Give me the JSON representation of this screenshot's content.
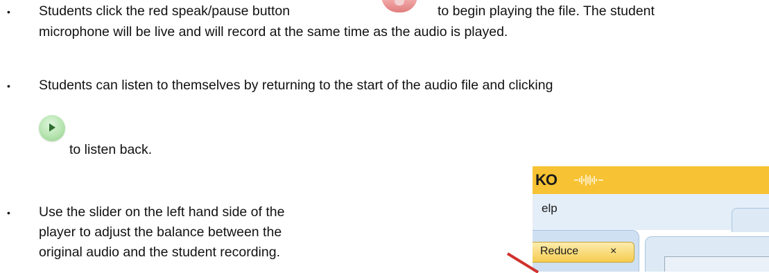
{
  "bullet_symbol": "•",
  "bullet1": {
    "before_icon": "Students click the red speak/pause button",
    "after_icon": "to begin playing the file. The student",
    "line2": "microphone will be live and will record at the same time as the audio is played.",
    "icon": "record-button-icon"
  },
  "bullet2": {
    "line1": "Students can listen to themselves by returning to the start of the audio file and clicking",
    "after_icon": "to listen back.",
    "icon": "play-button-icon"
  },
  "bullet3": {
    "line1": "Use the slider on the left hand side of the",
    "line2": "player to adjust the balance between the",
    "line3": "original audio and the student recording."
  },
  "player": {
    "logo_text": "KO",
    "menu_text": "elp",
    "reduce_label": "Reduce",
    "close_symbol": "×"
  },
  "colors": {
    "topbar": "#f7c233",
    "arrow": "#d0312d",
    "play_green": "#b6e4b0",
    "record_red": "#e07d7d"
  }
}
